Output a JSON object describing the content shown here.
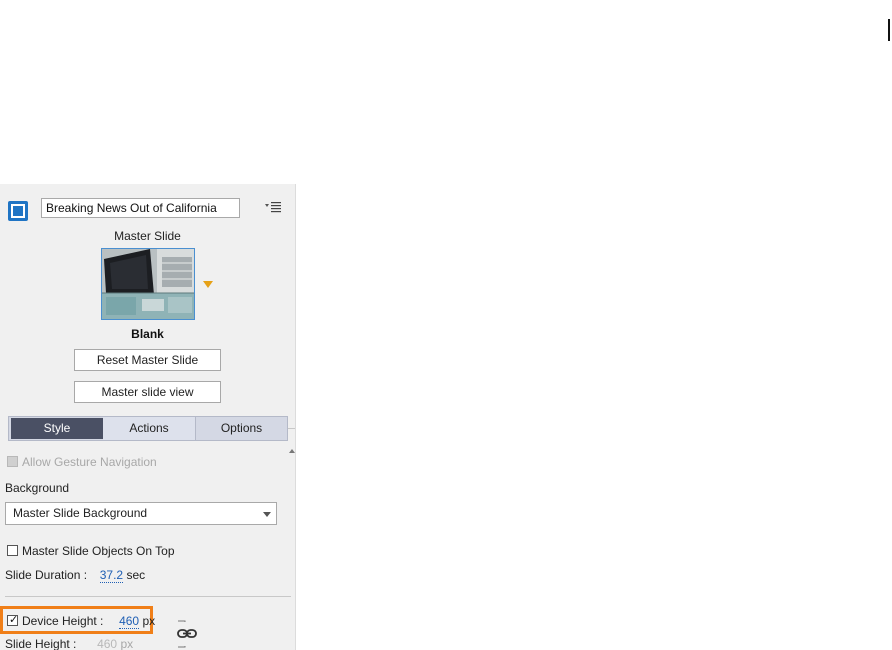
{
  "slide": {
    "name": "Breaking News Out of California",
    "master_label": "Master Slide",
    "master_name": "Blank",
    "reset_button": "Reset Master Slide",
    "view_button": "Master slide view"
  },
  "tabs": [
    {
      "label": "Style",
      "active": true
    },
    {
      "label": "Actions",
      "active": false
    },
    {
      "label": "Options",
      "active": false
    }
  ],
  "style": {
    "allow_gesture_label": "Allow Gesture Navigation",
    "background_label": "Background",
    "background_value": "Master Slide Background",
    "master_objects_label": "Master Slide Objects On Top",
    "slide_duration_label": "Slide Duration :",
    "slide_duration_value": "37.2",
    "slide_duration_unit": "sec",
    "device_height_label": "Device Height :",
    "device_height_value": "460",
    "device_height_unit": "px",
    "device_height_checked": true,
    "slide_height_label": "Slide Height :",
    "slide_height_value": "460",
    "slide_height_unit": "px"
  },
  "colors": {
    "accent": "#1f74c4",
    "highlight": "#f07f18",
    "active_tab": "#4a5064",
    "dropdown_marker": "#e6a117"
  },
  "icons": [
    "slide-icon",
    "panel-menu-icon",
    "dropdown-arrow-icon",
    "link-icon",
    "scroll-up-icon"
  ]
}
